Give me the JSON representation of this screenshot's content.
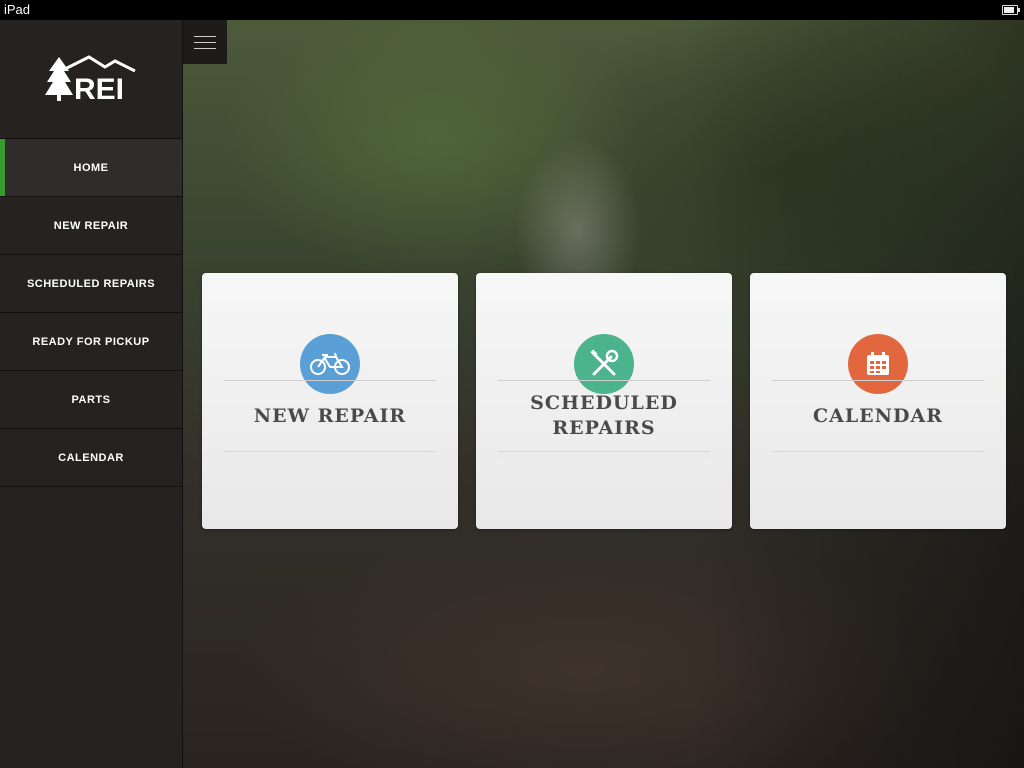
{
  "status_bar": {
    "device": "iPad",
    "battery_level": 0.85
  },
  "brand": {
    "logo_text": "REI",
    "accent": "#3a9a2e"
  },
  "sidebar": {
    "items": [
      {
        "label": "HOME",
        "active": true
      },
      {
        "label": "NEW REPAIR",
        "active": false
      },
      {
        "label": "SCHEDULED REPAIRS",
        "active": false
      },
      {
        "label": "READY FOR PICKUP",
        "active": false
      },
      {
        "label": "PARTS",
        "active": false
      },
      {
        "label": "CALENDAR",
        "active": false
      }
    ]
  },
  "main": {
    "menu_icon": "hamburger-icon",
    "cards": [
      {
        "label": "NEW REPAIR",
        "icon": "bicycle-icon",
        "color": "#5aa0d6"
      },
      {
        "label": "SCHEDULED\nREPAIRS",
        "icon": "tools-icon",
        "color": "#4cb48c"
      },
      {
        "label": "CALENDAR",
        "icon": "calendar-icon",
        "color": "#e2673e"
      }
    ]
  }
}
